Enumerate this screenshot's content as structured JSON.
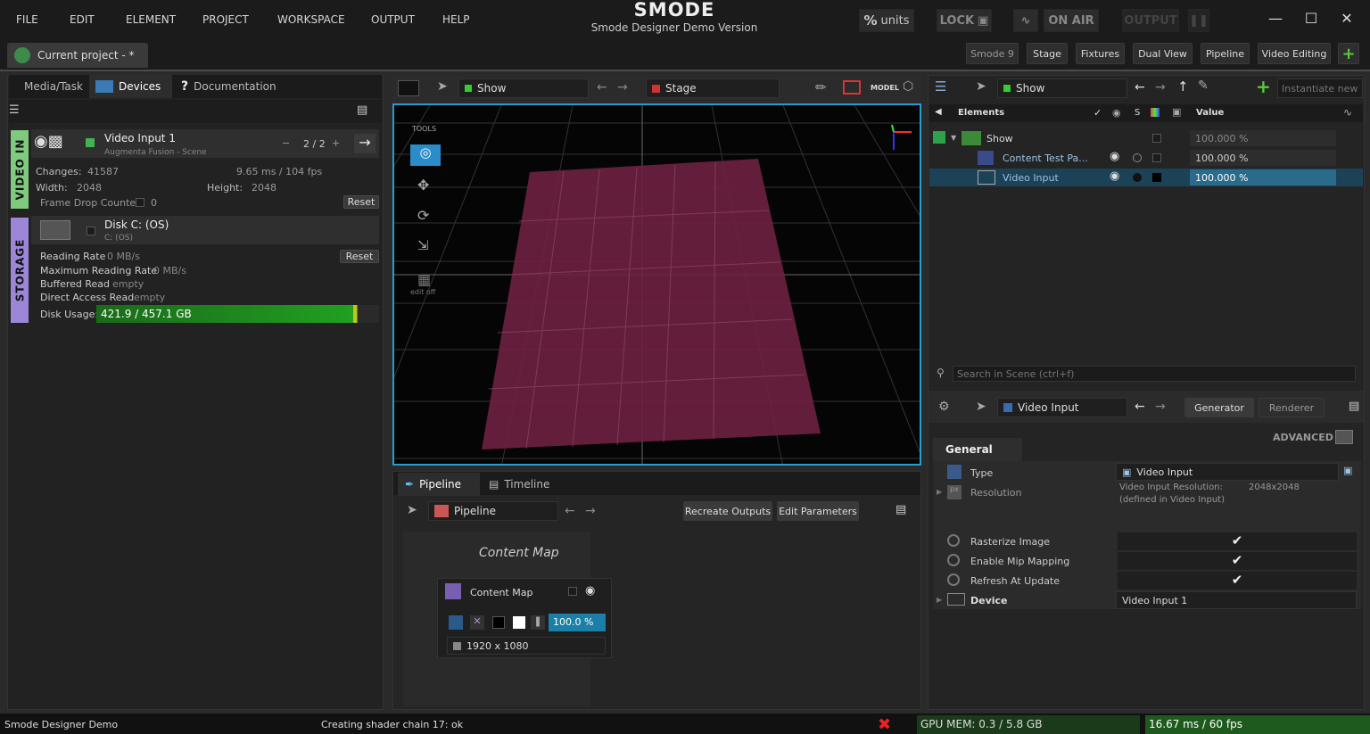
{
  "menu": [
    "FILE",
    "EDIT",
    "ELEMENT",
    "PROJECT",
    "WORKSPACE",
    "OUTPUT",
    "HELP"
  ],
  "brand": {
    "logo": "SMODE",
    "subtitle": "Smode Designer Demo Version"
  },
  "toolbar": {
    "units": "units",
    "units_symbol": "%",
    "lock": "LOCK",
    "on_air": "ON AIR",
    "output": "OUTPUT"
  },
  "project_tab": "Current project - *",
  "layouts": [
    "Smode 9",
    "Stage",
    "Fixtures",
    "Dual View",
    "Pipeline",
    "Video Editing"
  ],
  "left": {
    "tabs": [
      "Media/Task",
      "Devices",
      "Documentation"
    ],
    "video_in_label": "VIDEO IN",
    "storage_label": "STORAGE",
    "video_input": {
      "name": "Video Input 1",
      "sub": "Augmenta Fusion - Scene",
      "counter": "2 / 2",
      "changes_label": "Changes:",
      "changes": "41587",
      "timing": "9.65 ms / 104 fps",
      "width_label": "Width:",
      "width": "2048",
      "height_label": "Height:",
      "height": "2048",
      "frame_drop_label": "Frame Drop Counter",
      "frame_drop": "0",
      "reset": "Reset"
    },
    "disk": {
      "name": "Disk C: (OS)",
      "sub": "C: (OS)",
      "rows": [
        {
          "k": "Reading Rate",
          "v": "0 MB/s"
        },
        {
          "k": "Maximum Reading Rate",
          "v": "0 MB/s"
        },
        {
          "k": "Buffered Read",
          "v": "empty"
        },
        {
          "k": "Direct Access Read",
          "v": "empty"
        }
      ],
      "reset": "Reset",
      "usage_label": "Disk Usage:",
      "usage": "421.9 / 457.1 GB",
      "usage_fraction": 0.923
    }
  },
  "viewport": {
    "show": "Show",
    "stage": "Stage",
    "model": "MODEL",
    "tools_label": "TOOLS",
    "edit_off": "edit off"
  },
  "bottom": {
    "tabs": [
      "Pipeline",
      "Timeline"
    ],
    "pipeline_dd": "Pipeline",
    "recreate": "Recreate Outputs",
    "edit_params": "Edit Parameters",
    "node_title": "Content Map",
    "node_name": "Content Map",
    "percent": "100.0 %",
    "resolution": "1920 x 1080"
  },
  "right": {
    "show": "Show",
    "instantiate_placeholder": "Instantiate new Ele",
    "tree_headers": {
      "elements": "Elements",
      "s": "S",
      "value": "Value"
    },
    "tree": [
      {
        "name": "Show",
        "value": "100.000 %"
      },
      {
        "name": "Content Test Pa...",
        "value": "100.000 %"
      },
      {
        "name": "Video Input",
        "value": "100.000 %"
      }
    ],
    "search_placeholder": "Search in Scene (ctrl+f)",
    "inspector": {
      "element": "Video Input",
      "generator": "Generator",
      "renderer": "Renderer",
      "advanced": "ADVANCED",
      "section": "General",
      "type_label": "Type",
      "type_value": "Video Input",
      "resolution_label": "Resolution",
      "res_line1": "Video Input Resolution:",
      "res_value": "2048x2048",
      "res_line2": "(defined in Video Input)",
      "rasterize": "Rasterize Image",
      "mip": "Enable Mip Mapping",
      "refresh": "Refresh At Update",
      "device_label": "Device",
      "device_value": "Video Input 1"
    }
  },
  "status": {
    "app": "Smode Designer Demo",
    "message": "Creating shader chain 17: ok",
    "gpu": "GPU MEM: 0.3 / 5.8 GB",
    "fps": "16.67 ms / 60 fps"
  }
}
